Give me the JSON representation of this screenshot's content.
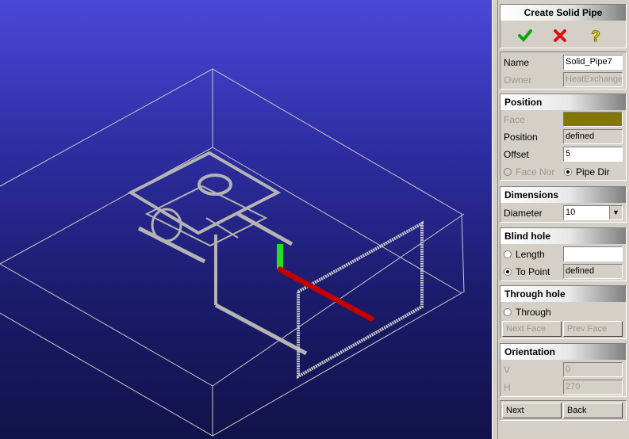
{
  "panel": {
    "title": "Create Solid Pipe",
    "actions": {
      "ok_icon": "check-icon",
      "cancel_icon": "cross-icon",
      "help_icon": "question-icon"
    },
    "general": {
      "name_label": "Name",
      "name_value": "Solid_Pipe7",
      "owner_label": "Owner",
      "owner_value": "HeatExchange"
    },
    "position": {
      "header": "Position",
      "face_label": "Face",
      "face_color": "#807800",
      "position_label": "Position",
      "position_value": "defined",
      "offset_label": "Offset",
      "offset_value": "5",
      "face_normal_label": "Face Nor",
      "pipe_dir_label": "Pipe Dir",
      "selected": "pipe_dir"
    },
    "dimensions": {
      "header": "Dimensions",
      "diameter_label": "Diameter",
      "diameter_value": "10"
    },
    "blind_hole": {
      "header": "Blind hole",
      "length_label": "Length",
      "length_value": "",
      "to_point_label": "To Point",
      "to_point_value": "defined",
      "selected": "to_point"
    },
    "through_hole": {
      "header": "Through hole",
      "through_label": "Through",
      "next_face_label": "Next Face",
      "prev_face_label": "Prev Face"
    },
    "orientation": {
      "header": "Orientation",
      "v_label": "V",
      "v_value": "0",
      "h_label": "H",
      "h_value": "270"
    },
    "nav": {
      "next_label": "Next",
      "back_label": "Back"
    }
  },
  "colors": {
    "pipe_selected": "#c00000",
    "pipe_green": "#20e020",
    "wireframe": "#c8c8c8",
    "bg_top": "#4a48d8",
    "bg_bottom": "#12124a"
  }
}
